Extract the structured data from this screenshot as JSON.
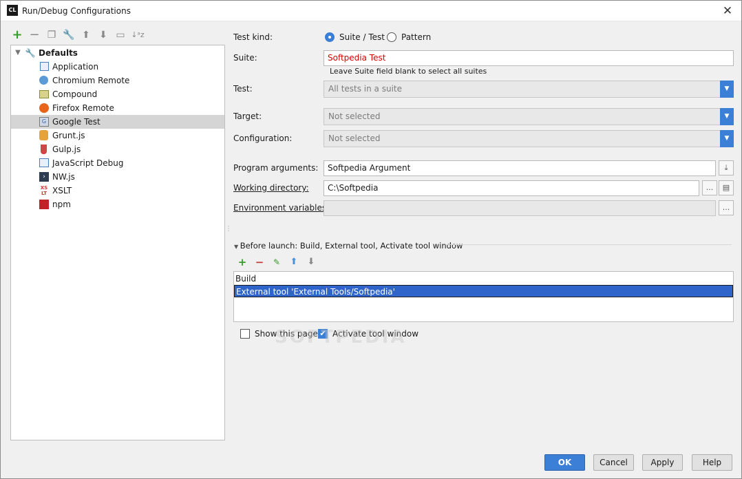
{
  "window": {
    "title": "Run/Debug Configurations",
    "app_icon": "CL"
  },
  "toolbar": {
    "icons": [
      "add-icon",
      "remove-icon",
      "copy-icon",
      "edit-defaults-icon",
      "move-up-icon",
      "move-down-icon",
      "folder-icon",
      "sort-icon"
    ]
  },
  "tree": {
    "root": "Defaults",
    "items": [
      {
        "label": "Application",
        "icon": "application-icon"
      },
      {
        "label": "Chromium Remote",
        "icon": "chromium-icon"
      },
      {
        "label": "Compound",
        "icon": "compound-icon"
      },
      {
        "label": "Firefox Remote",
        "icon": "firefox-icon"
      },
      {
        "label": "Google Test",
        "icon": "google-test-icon",
        "selected": true
      },
      {
        "label": "Grunt.js",
        "icon": "grunt-icon"
      },
      {
        "label": "Gulp.js",
        "icon": "gulp-icon"
      },
      {
        "label": "JavaScript Debug",
        "icon": "javascript-debug-icon"
      },
      {
        "label": "NW.js",
        "icon": "nwjs-icon"
      },
      {
        "label": "XSLT",
        "icon": "xslt-icon"
      },
      {
        "label": "npm",
        "icon": "npm-icon"
      }
    ]
  },
  "form": {
    "test_kind_label": "Test kind:",
    "test_kind_options": [
      "Suite / Test",
      "Pattern"
    ],
    "test_kind_selected": "Suite / Test",
    "suite_label": "Suite:",
    "suite_value": "Softpedia Test",
    "suite_hint": "Leave Suite field blank to select all suites",
    "test_label": "Test:",
    "test_value": "All tests in a suite",
    "target_label": "Target:",
    "target_value": "Not selected",
    "configuration_label": "Configuration:",
    "configuration_value": "Not selected",
    "program_args_label": "Program arguments:",
    "program_args_value": "Softpedia Argument",
    "working_dir_label": "Working directory:",
    "working_dir_value": "C:\\Softpedia",
    "env_vars_label": "Environment variables:",
    "env_vars_value": "",
    "browse_label": "..."
  },
  "before_launch": {
    "title": "Before launch: Build, External tool, Activate tool window",
    "items": [
      "Build",
      "External tool 'External Tools/Softpedia'"
    ],
    "selected_index": 1
  },
  "options": {
    "show_page_label": "Show this page",
    "show_page_checked": false,
    "activate_label": "Activate tool window",
    "activate_checked": true
  },
  "watermark": "SOFTPEDIA",
  "buttons": {
    "ok": "OK",
    "cancel": "Cancel",
    "apply": "Apply",
    "help": "Help"
  },
  "colors": {
    "accent": "#3b7fd6",
    "selection": "#2f65ca",
    "error_text": "#d80000",
    "add_green": "#3a9b2c",
    "remove_red": "#c53a3a"
  }
}
